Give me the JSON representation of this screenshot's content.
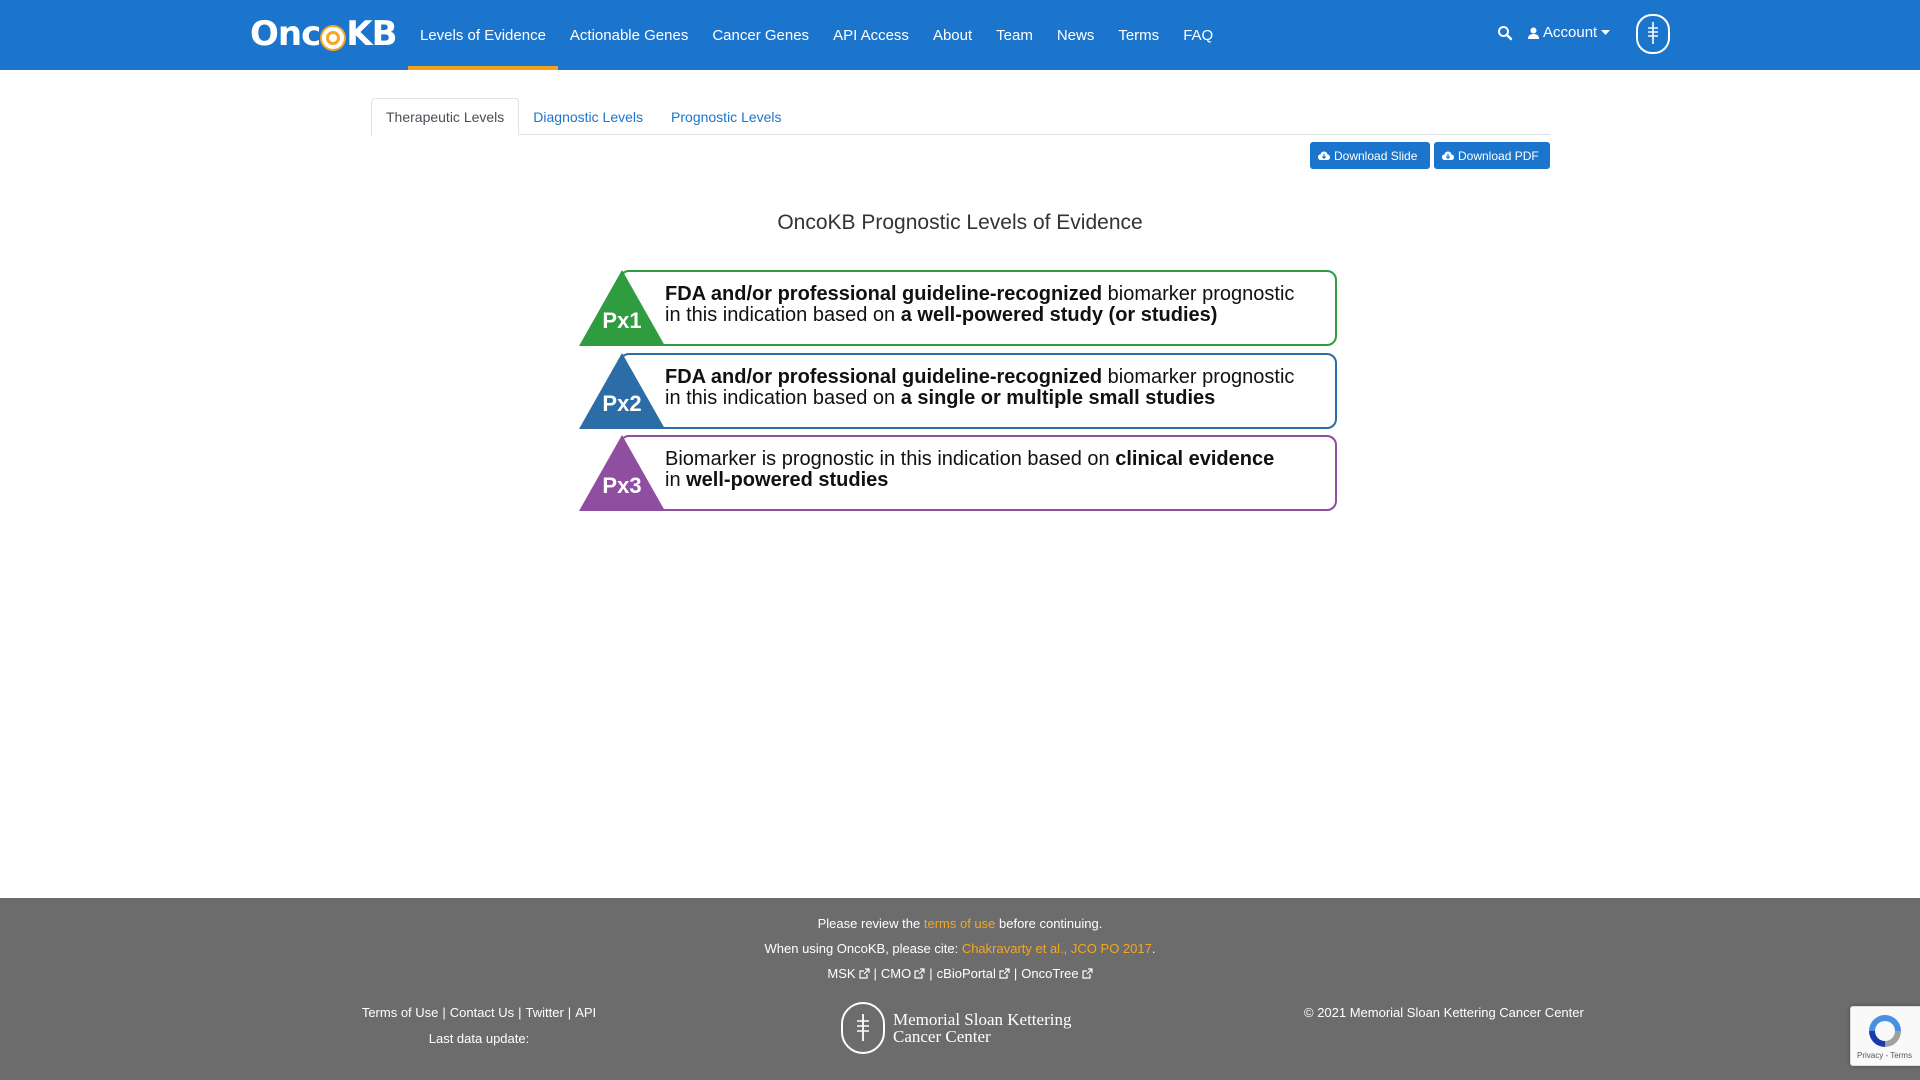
{
  "header": {
    "logo_text_pre": "Onc",
    "logo_text_post": "KB",
    "nav": [
      {
        "label": "Levels of Evidence",
        "active": true
      },
      {
        "label": "Actionable Genes"
      },
      {
        "label": "Cancer Genes"
      },
      {
        "label": "API Access"
      },
      {
        "label": "About"
      },
      {
        "label": "Team"
      },
      {
        "label": "News"
      },
      {
        "label": "Terms"
      },
      {
        "label": "FAQ"
      }
    ],
    "account_label": "Account",
    "icons": {
      "search": "search-icon",
      "account": "user-icon",
      "msk": "msk-emblem-icon"
    }
  },
  "tabs": [
    {
      "label": "Therapeutic Levels",
      "active": true
    },
    {
      "label": "Diagnostic Levels"
    },
    {
      "label": "Prognostic Levels"
    }
  ],
  "buttons": {
    "download_slide": "Download Slide",
    "download_pdf": "Download PDF"
  },
  "main": {
    "title": "OncoKB Prognostic Levels of Evidence",
    "levels": [
      {
        "level": "Px1",
        "color": "#2e9c3f",
        "line1_bold": "FDA and/or professional guideline-recognized",
        "line1_rest": " biomarker prognostic",
        "line2_plain": "in this indication based on ",
        "line2_bold": "a well-powered study (or studies)"
      },
      {
        "level": "Px2",
        "color": "#2c6da8",
        "line1_bold": "FDA and/or professional guideline-recognized",
        "line1_rest": " biomarker prognostic",
        "line2_plain": "in this indication based on ",
        "line2_bold": "a single or multiple small studies"
      },
      {
        "level": "Px3",
        "color": "#8f4ea0",
        "line1_plain": "Biomarker is prognostic in this indication based on ",
        "line1_bold": "clinical evidence",
        "line2_plain": "in ",
        "line2_bold": "well-powered studies"
      }
    ]
  },
  "footer": {
    "review_pre": "Please review the ",
    "review_link": "terms of use",
    "review_post": " before continuing.",
    "cite_pre": "When using OncoKB, please cite: ",
    "cite_link": "Chakravarty et al., JCO PO 2017",
    "cite_post": ".",
    "ext_links": [
      "MSK",
      "CMO",
      "cBioPortal",
      "OncoTree"
    ],
    "left_links": [
      "Terms of Use",
      "Contact Us",
      "Twitter",
      "API"
    ],
    "last_update": "Last data update:",
    "msk_name_line1": "Memorial Sloan Kettering",
    "msk_name_line2": "Cancer Center",
    "copyright": "© 2021 Memorial Sloan Kettering Cancer Center"
  },
  "recaptcha": {
    "text": "Privacy - Terms"
  }
}
